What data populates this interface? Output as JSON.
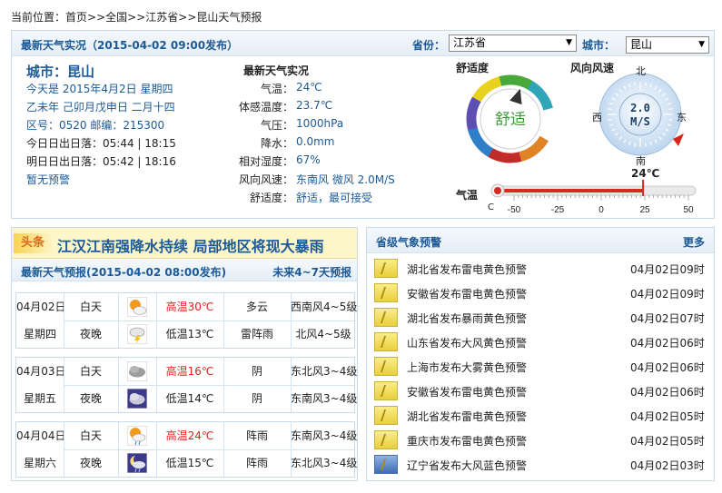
{
  "breadcrumb": {
    "prefix": "当前位置：",
    "home": "首页",
    "sep": ">>",
    "country": "全国",
    "province": "江苏省",
    "page": "昆山天气预报"
  },
  "top": {
    "title": "最新天气实况（2015-04-02 09:00发布）",
    "province_label": "省份：",
    "province_value": "江苏省",
    "city_label": "城市：",
    "city_value": "昆山"
  },
  "city": {
    "name": "城市：昆山",
    "today": "今天是 2015年4月2日 星期四",
    "lunar": "乙未年 己卯月戊申日 二月十四",
    "codes": "区号：0520 邮编：215300",
    "sun_today": "今日日出日落：05:44 | 18:15",
    "sun_tomorrow": "明日日出日落：05:42 | 18:16",
    "warning": "暂无预警"
  },
  "observation": {
    "title": "最新天气实况",
    "rows": [
      {
        "label": "气温：",
        "value": "24℃"
      },
      {
        "label": "体感温度：",
        "value": "23.7℃"
      },
      {
        "label": "气压：",
        "value": "1000hPa"
      },
      {
        "label": "降水：",
        "value": "0.0mm"
      },
      {
        "label": "相对湿度：",
        "value": "67%"
      },
      {
        "label": "风向风速：",
        "value": "东南风 微风 2.0M/S"
      },
      {
        "label": "舒适度：",
        "value": "舒适，最可接受"
      }
    ]
  },
  "comfort_gauge": {
    "title": "舒适度",
    "label": "舒适"
  },
  "wind_gauge": {
    "title": "风向风速",
    "speed": "2.0",
    "unit": "M/S",
    "north": "北",
    "south": "南",
    "east": "东",
    "west": "西"
  },
  "temp_bar": {
    "label": "气温",
    "unit": "C",
    "value_label": "24℃",
    "value": 24,
    "min": -50,
    "max": 50,
    "ticks": [
      "-50",
      "-25",
      "0",
      "25",
      "50"
    ]
  },
  "headline": {
    "tag": "头条",
    "text": "江汉江南强降水持续 局部地区将现大暴雨"
  },
  "forecast": {
    "title": "最新天气预报(2015-04-02 08:00发布)",
    "more": "未来4~7天预报",
    "days": [
      {
        "date": "04月02日",
        "weekday": "星期四",
        "day": {
          "period": "白天",
          "icon": "sun-cloud-icon",
          "temp": "高温30℃",
          "weather": "多云",
          "wind": "西南风4~5级"
        },
        "night": {
          "period": "夜晚",
          "icon": "thunderstorm-icon",
          "temp": "低温13℃",
          "weather": "雷阵雨",
          "wind": "北风4~5级"
        }
      },
      {
        "date": "04月03日",
        "weekday": "星期五",
        "day": {
          "period": "白天",
          "icon": "overcast-icon",
          "temp": "高温16℃",
          "weather": "阴",
          "wind": "东北风3~4级"
        },
        "night": {
          "period": "夜晚",
          "icon": "night-overcast-icon",
          "temp": "低温14℃",
          "weather": "阴",
          "wind": "东南风3~4级"
        }
      },
      {
        "date": "04月04日",
        "weekday": "星期六",
        "day": {
          "period": "白天",
          "icon": "sun-shower-icon",
          "temp": "高温24℃",
          "weather": "阵雨",
          "wind": "东南风3~4级"
        },
        "night": {
          "period": "夜晚",
          "icon": "night-shower-icon",
          "temp": "低温15℃",
          "weather": "阵雨",
          "wind": "东北风3~4级"
        }
      }
    ]
  },
  "warnings": {
    "title": "省级气象预警",
    "more": "更多",
    "items": [
      {
        "text": "湖北省发布雷电黄色预警",
        "time": "04月02日09时",
        "color": "yellow"
      },
      {
        "text": "安徽省发布雷电黄色预警",
        "time": "04月02日09时",
        "color": "yellow"
      },
      {
        "text": "湖北省发布暴雨黄色预警",
        "time": "04月02日07时",
        "color": "yellow"
      },
      {
        "text": "山东省发布大风黄色预警",
        "time": "04月02日06时",
        "color": "yellow"
      },
      {
        "text": "上海市发布大雾黄色预警",
        "time": "04月02日06时",
        "color": "yellow"
      },
      {
        "text": "安徽省发布雷电黄色预警",
        "time": "04月02日06时",
        "color": "yellow"
      },
      {
        "text": "湖北省发布雷电黄色预警",
        "time": "04月02日05时",
        "color": "yellow"
      },
      {
        "text": "重庆市发布雷电黄色预警",
        "time": "04月02日05时",
        "color": "yellow"
      },
      {
        "text": "辽宁省发布大风蓝色预警",
        "time": "04月02日03时",
        "color": "blue"
      }
    ]
  },
  "colors": {
    "title_blue": "#1c5a97",
    "high_temp_red": "#d9261c",
    "comfort_green": "#3a9b3a",
    "thermometer_red": "#d42a1f"
  }
}
